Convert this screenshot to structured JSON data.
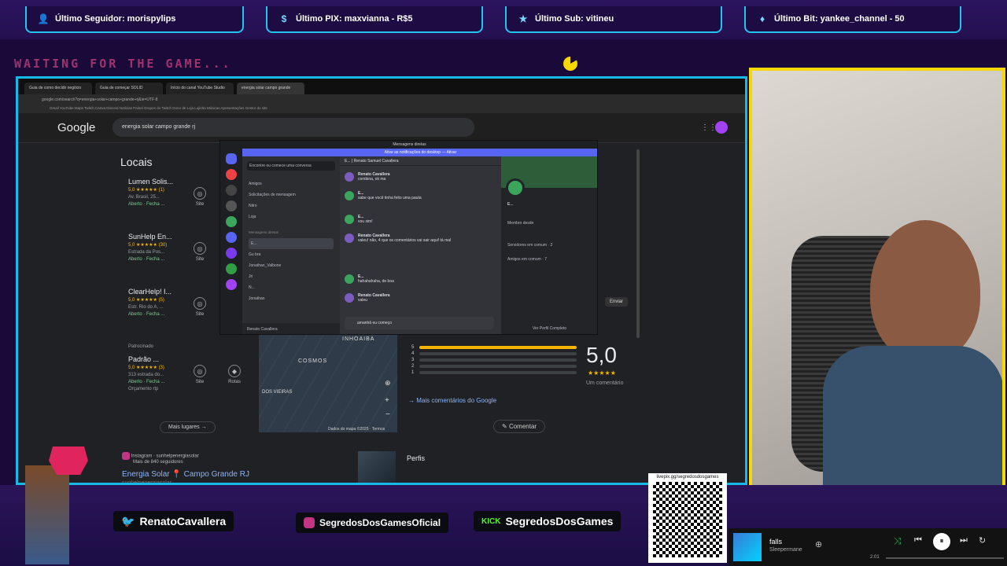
{
  "alerts": [
    {
      "icon": "user-icon",
      "text": "Último Seguidor: morispylips"
    },
    {
      "icon": "dollar-icon",
      "text": "Último PIX: maxvianna - R$5"
    },
    {
      "icon": "star-icon",
      "text": "Último Sub: vitineu"
    },
    {
      "icon": "diamond-icon",
      "text": "Último Bit: yankee_channel - 50"
    }
  ],
  "waiting_text": "WAITING FOR THE GAME...",
  "browser": {
    "tabs": [
      "Guia de como decidir negócio",
      "Guia de começar SOLID",
      "Início do canal YouTube Studio",
      "energia solar campo grande"
    ],
    "address": "google.com/search?q=energia+solar+campo+grande+rj&ie=UTF-8",
    "bookmarks": "Gmail YouTube Maps Twitch Canva Discord Notícias Painel Grupos do Twitch Dono de Loja Lojinha Músicas Apresentações Gestor do site",
    "google_logo": "Google",
    "search_query": "energia solar campo grande rj"
  },
  "results": {
    "section_title": "Locais",
    "places": [
      {
        "name": "Lumen Solis...",
        "rating": "5,0 ★★★★★ (1)",
        "address": "Av. Brasil, 25...",
        "status": "Aberto · Fecha ..."
      },
      {
        "name": "SunHelp En...",
        "rating": "5,0 ★★★★★ (30)",
        "address": "Estrada da Pos...",
        "status": "Aberto · Fecha ..."
      },
      {
        "name": "ClearHelp! I...",
        "rating": "5,0 ★★★★★ (5)",
        "address": "Estr. Rio do A, ...",
        "status": "Aberto · Fecha ..."
      }
    ],
    "sponsored_label": "Patrocinado",
    "sponsored": {
      "name": "Padrão ...",
      "rating": "5,0 ★★★★★ (3)",
      "address": "313 estrada do...",
      "status": "Aberto · Fecha ...",
      "extra": "Orçamento rtp"
    },
    "site_label": "Site",
    "routes_label": "Rotas",
    "more_places": "Mais lugares",
    "instagram": {
      "line1": "Instagram · sunhelpenergiasolar",
      "line2": "Mais de 840 seguidores",
      "title": "Energia Solar 📍 Campo Grande RJ",
      "handle": "sunhelpenergiasolar"
    },
    "perfis": "Perfis",
    "map": {
      "labels": [
        "INHOAIBA",
        "COSMOS",
        "DOS VIEIRAS"
      ],
      "footer": "Dados do mapa ©2025 · Termos"
    },
    "rating": {
      "value": "5,0",
      "stars": "★★★★★",
      "count_label": "Um comentário",
      "rows": [
        "5",
        "4",
        "3",
        "2",
        "1"
      ],
      "fill": [
        1,
        0,
        0,
        0,
        0
      ]
    },
    "more_reviews": "Mais comentários do Google",
    "comment": "Comentar",
    "enviar": "Enviar"
  },
  "discord": {
    "title": "Mensagens diretas",
    "banner": "Ative as notificações do desktop — Ativar",
    "search": "Encontre ou comece uma conversa",
    "nav": [
      "Amigos",
      "Solicitações de mensagem",
      "Nitro",
      "Loja"
    ],
    "section": "Mensagens diretas",
    "dms": [
      "E...",
      "Gu bra",
      "Jonathan_Valbone",
      "Jri",
      "N...",
      "Jonathan"
    ],
    "user": "Renato Cavallera",
    "chat_header": "E... | Renato Samuel Cavallera",
    "messages": [
      {
        "author": "Renato Cavallera",
        "text": "combina, ok ma"
      },
      {
        "author": "E...",
        "text": "sabe que você tinha feito uma pauta"
      },
      {
        "author": "E...",
        "text": "vou sim!"
      },
      {
        "author": "Renato Cavallera",
        "text": "valeu! não, 4 que os comentários vai sair aqui! tá mal"
      },
      {
        "author": "E...",
        "text": "hahahahaha, de boa"
      },
      {
        "author": "Renato Cavallera",
        "text": "valeu"
      }
    ],
    "input": "amanhã eu começo",
    "profile": {
      "name": "E...",
      "member_since": "Membro desde",
      "servers": "Servidores em comum · 2",
      "friends": "Amigos em comum · 7",
      "full": "Ver Perfil Completo"
    }
  },
  "socials": [
    {
      "icon": "twitter-icon",
      "text": "RenatoCavallera"
    },
    {
      "icon": "instagram-icon",
      "text": "SegredosDosGamesOficial"
    },
    {
      "icon": "kick-icon",
      "text": "SegredosDosGames"
    }
  ],
  "qr_label": "livepix.gg/segredosdosgames",
  "music": {
    "title": "falls",
    "artist": "Sleepermane",
    "time": "2:01"
  },
  "colors": {
    "accent": "#18b9e8",
    "camera_border": "#f7d800",
    "kick": "#53fc18"
  }
}
